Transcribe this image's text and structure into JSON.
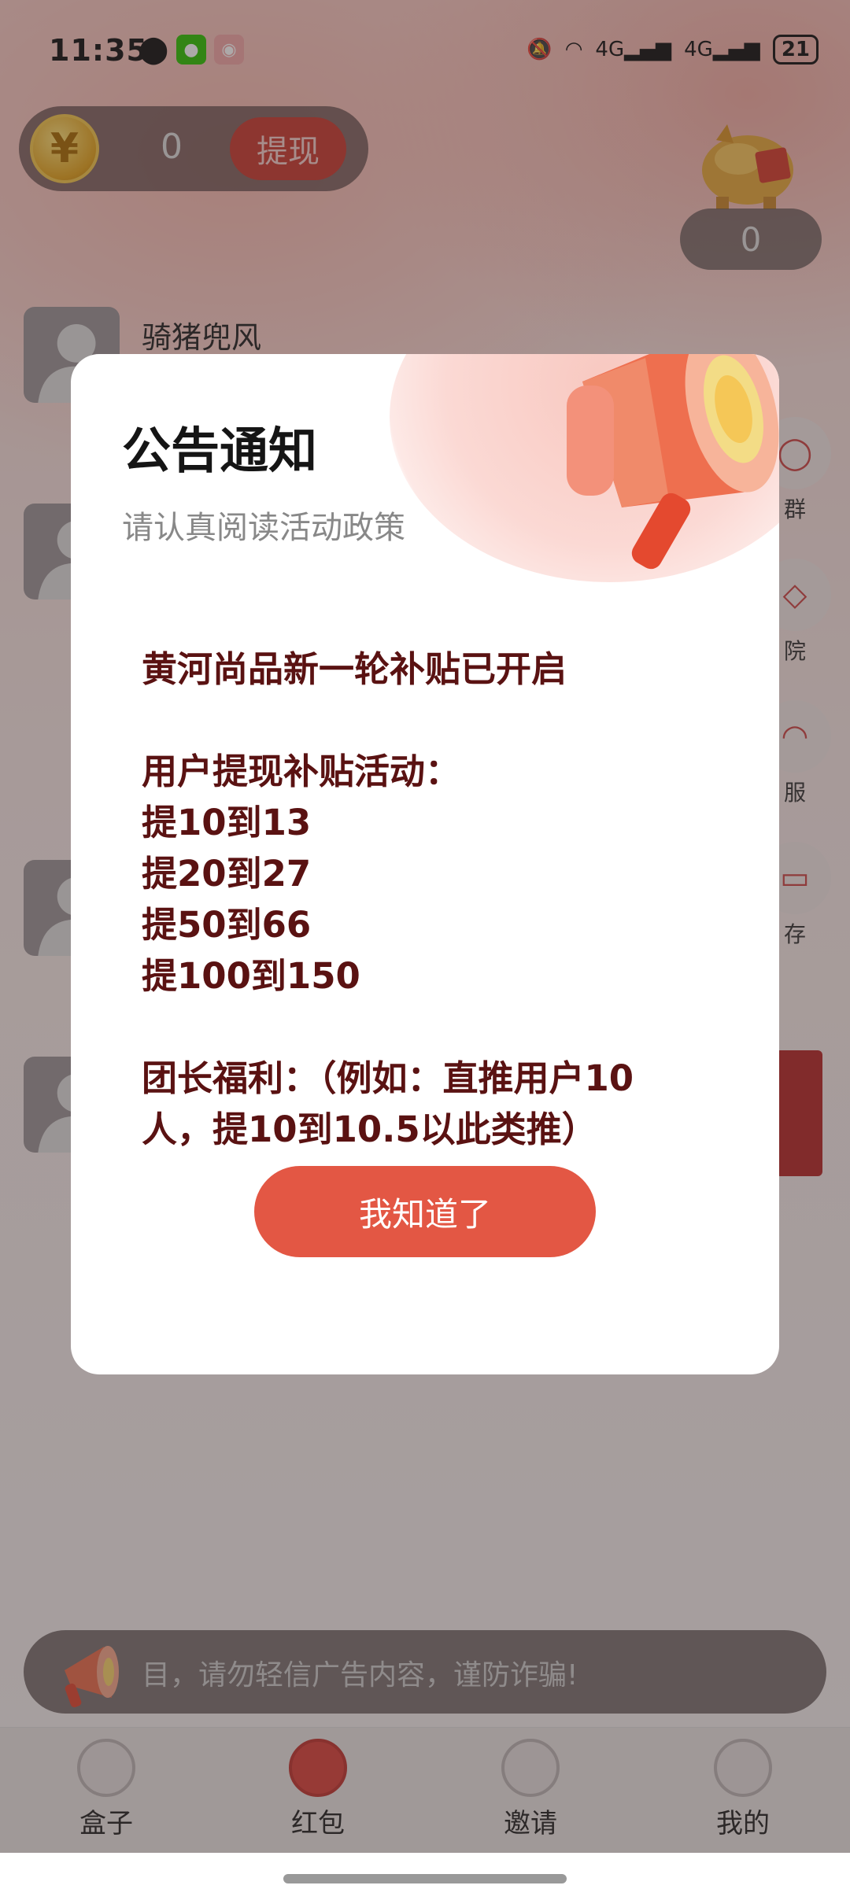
{
  "status_bar": {
    "time": "11:35",
    "network_1": "4G",
    "network_2": "4G",
    "battery": "21"
  },
  "wallet": {
    "balance": "0",
    "withdraw_label": "提现",
    "coin_symbol": "¥"
  },
  "piggy": {
    "count": "0"
  },
  "users": [
    {
      "name": "骑猪兜风"
    }
  ],
  "side_menu": [
    {
      "label": "群",
      "icon": "chat-icon"
    },
    {
      "label": "院",
      "icon": "graduation-cap-icon"
    },
    {
      "label": "服",
      "icon": "headset-icon"
    },
    {
      "label": "存",
      "icon": "box-icon"
    }
  ],
  "dialog": {
    "title": "公告通知",
    "subtitle": "请认真阅读活动政策",
    "lines": [
      "黄河尚品新一轮补贴已开启",
      "",
      "用户提现补贴活动：",
      "提10到13",
      "提20到27",
      "提50到66",
      "提100到150",
      "",
      "团长福利：（例如：直推用户10",
      "人，提10到10.5以此类推）"
    ],
    "ok_label": "我知道了"
  },
  "notice": {
    "text": "目，请勿轻信广告内容，谨防诈骗!"
  },
  "tabs": [
    {
      "label": "盒子",
      "icon": "box-tab-icon",
      "active": false
    },
    {
      "label": "红包",
      "icon": "red-packet-icon",
      "active": true
    },
    {
      "label": "邀请",
      "icon": "invite-icon",
      "active": false
    },
    {
      "label": "我的",
      "icon": "profile-icon",
      "active": false
    }
  ],
  "colors": {
    "accent": "#e35744",
    "body_text": "#5a1212"
  }
}
